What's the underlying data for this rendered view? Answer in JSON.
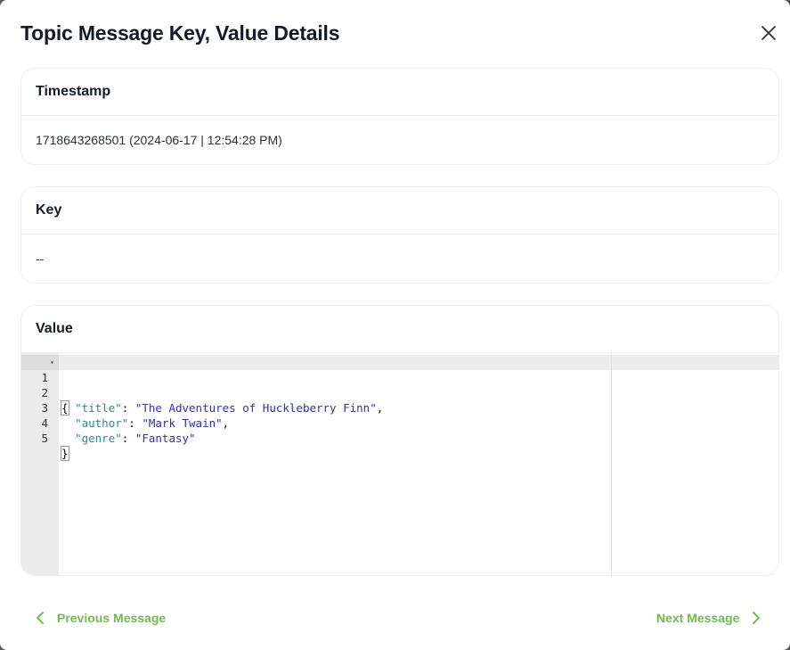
{
  "modal": {
    "title": "Topic Message Key, Value Details"
  },
  "timestamp": {
    "label": "Timestamp",
    "value": "1718643268501 (2024-06-17 | 12:54:28 PM)"
  },
  "key": {
    "label": "Key",
    "value": "--"
  },
  "value": {
    "label": "Value",
    "line_numbers": [
      "1",
      "2",
      "3",
      "4",
      "5"
    ],
    "lines": {
      "l1_open": "{",
      "l2_key": "\"title\"",
      "l2_val": "\"The Adventures of Huckleberry Finn\"",
      "l3_key": "\"author\"",
      "l3_val": "\"Mark Twain\"",
      "l4_key": "\"genre\"",
      "l4_val": "\"Fantasy\"",
      "l5_close": "}"
    }
  },
  "footer": {
    "prev_label": "Previous Message",
    "next_label": "Next Message"
  },
  "colors": {
    "accent_green": "#6abf4b",
    "json_key": "#2a8a92",
    "json_string": "#2d2dc4"
  },
  "icons": {
    "close": "close-icon",
    "prev": "chevron-left-icon",
    "next": "chevron-right-icon",
    "fold": "fold-arrow-icon"
  }
}
